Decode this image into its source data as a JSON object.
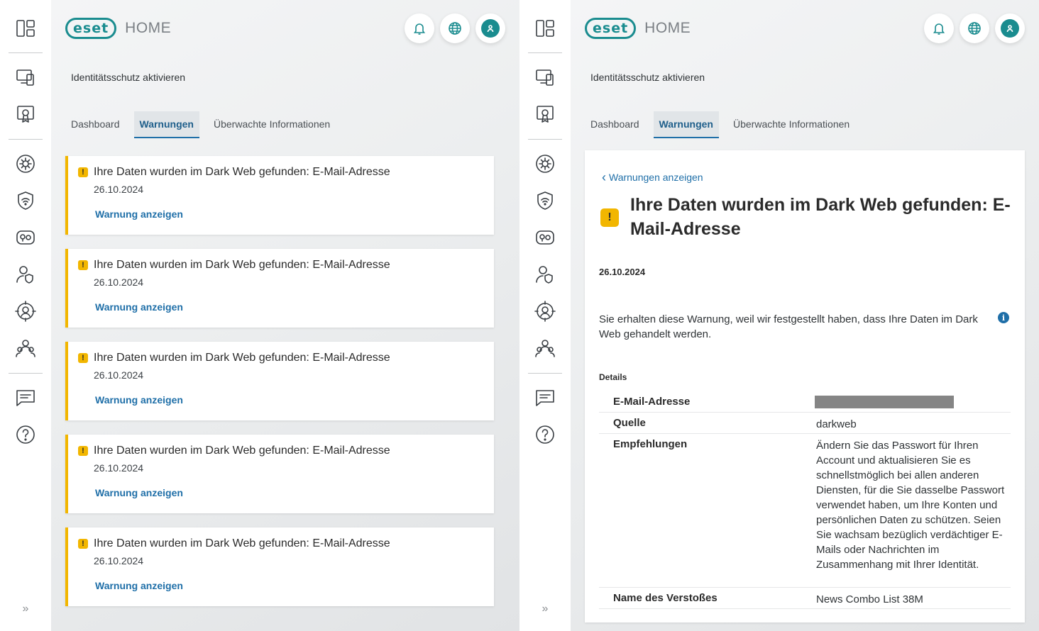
{
  "app": {
    "logo_text": "eset",
    "logo_home": "HOME",
    "brand_color": "#1a8c8f",
    "accent_color": "#f2b600",
    "link_color": "#1f6fa8"
  },
  "sidebar": {
    "items": [
      {
        "icon": "dashboard-icon"
      },
      {
        "icon": "devices-icon"
      },
      {
        "icon": "license-icon"
      },
      {
        "icon": "settings-gear-icon"
      },
      {
        "icon": "wifi-shield-icon"
      },
      {
        "icon": "device-gear-icon"
      },
      {
        "icon": "user-shield-icon"
      },
      {
        "icon": "identity-monitor-icon"
      },
      {
        "icon": "family-icon"
      },
      {
        "icon": "message-icon"
      },
      {
        "icon": "help-icon"
      }
    ],
    "expand_label": "»"
  },
  "header": {
    "breadcrumb": "Identitätsschutz aktivieren",
    "buttons": [
      "bell-icon",
      "globe-icon",
      "user-icon"
    ]
  },
  "tabs": [
    {
      "label": "Dashboard"
    },
    {
      "label": "Warnungen",
      "active": true
    },
    {
      "label": "Überwachte Informationen"
    }
  ],
  "alerts": [
    {
      "title": "Ihre Daten wurden im Dark Web gefunden: E-Mail-Adresse",
      "date": "26.10.2024",
      "link": "Warnung anzeigen"
    },
    {
      "title": "Ihre Daten wurden im Dark Web gefunden: E-Mail-Adresse",
      "date": "26.10.2024",
      "link": "Warnung anzeigen"
    },
    {
      "title": "Ihre Daten wurden im Dark Web gefunden: E-Mail-Adresse",
      "date": "26.10.2024",
      "link": "Warnung anzeigen"
    },
    {
      "title": "Ihre Daten wurden im Dark Web gefunden: E-Mail-Adresse",
      "date": "26.10.2024",
      "link": "Warnung anzeigen"
    },
    {
      "title": "Ihre Daten wurden im Dark Web gefunden: E-Mail-Adresse",
      "date": "26.10.2024",
      "link": "Warnung anzeigen"
    }
  ],
  "detail": {
    "back_label": "Warnungen anzeigen",
    "title": "Ihre Daten wurden im Dark Web gefunden: E-Mail-Adresse",
    "date": "26.10.2024",
    "description": "Sie erhalten diese Warnung, weil wir festgestellt haben, dass Ihre Daten im Dark Web gehandelt werden.",
    "details_heading": "Details",
    "rows": [
      {
        "key": "E-Mail-Adresse",
        "value": ""
      },
      {
        "key": "Quelle",
        "value": "darkweb"
      },
      {
        "key": "Empfehlungen",
        "value": "Ändern Sie das Passwort für Ihren Account und aktualisieren Sie es schnellstmöglich bei allen anderen Diensten, für die Sie dasselbe Passwort verwendet haben, um Ihre Konten und persönlichen Daten zu schützen. Seien Sie wachsam bezüglich verdächtiger E-Mails oder Nachrichten im Zusammenhang mit Ihrer Identität."
      },
      {
        "key": "Name des Verstoßes",
        "value": "News Combo List 38M"
      }
    ]
  }
}
